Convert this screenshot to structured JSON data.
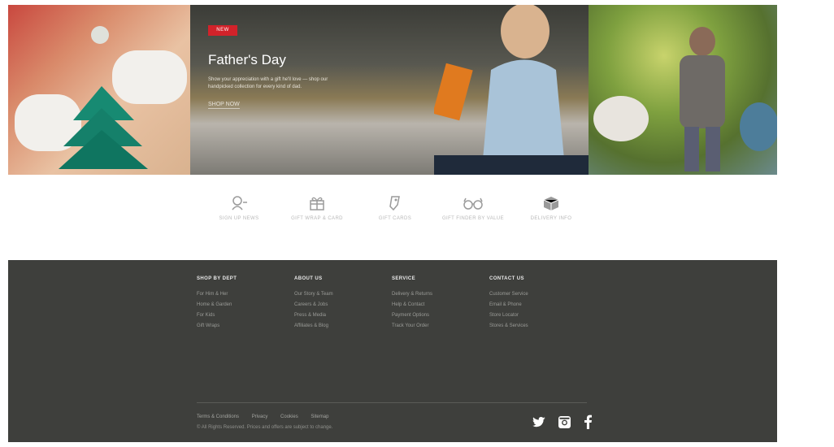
{
  "hero": {
    "badge": "NEW",
    "title": "Father's Day",
    "description": "Show your appreciation with a gift he'll love — shop our handpicked collection for every kind of dad.",
    "link_label": "SHOP NOW",
    "colors": {
      "badge": "#d2222a",
      "text": "#ffffff"
    }
  },
  "features": [
    {
      "icon": "sign-up-icon",
      "label": "SIGN UP NEWS"
    },
    {
      "icon": "gift-box-icon",
      "label": "GIFT WRAP & CARD"
    },
    {
      "icon": "gift-tag-icon",
      "label": "GIFT CARDS"
    },
    {
      "icon": "glasses-icon",
      "label": "GIFT FINDER BY VALUE"
    },
    {
      "icon": "package-icon",
      "label": "DELIVERY INFO"
    }
  ],
  "footer": {
    "columns": [
      {
        "title": "SHOP BY DEPT",
        "items": [
          "For Him & Her",
          "Home & Garden",
          "For Kids",
          "Gift Wraps"
        ]
      },
      {
        "title": "ABOUT US",
        "items": [
          "Our Story & Team",
          "Careers & Jobs",
          "Press & Media",
          "Affiliates & Blog"
        ]
      },
      {
        "title": "SERVICE",
        "items": [
          "Delivery & Returns",
          "Help & Contact",
          "Payment Options",
          "Track Your Order"
        ]
      },
      {
        "title": "CONTACT US",
        "items": [
          "Customer Service",
          "Email & Phone",
          "Store Locator",
          "Stores & Services"
        ]
      }
    ],
    "legal_links": [
      "Terms & Conditions",
      "Privacy",
      "Cookies",
      "Sitemap"
    ],
    "copyright": "© All Rights Reserved. Prices and offers are subject to change.",
    "social": [
      "twitter-icon",
      "instagram-icon",
      "facebook-icon"
    ],
    "colors": {
      "background": "#3e3f3c"
    }
  }
}
